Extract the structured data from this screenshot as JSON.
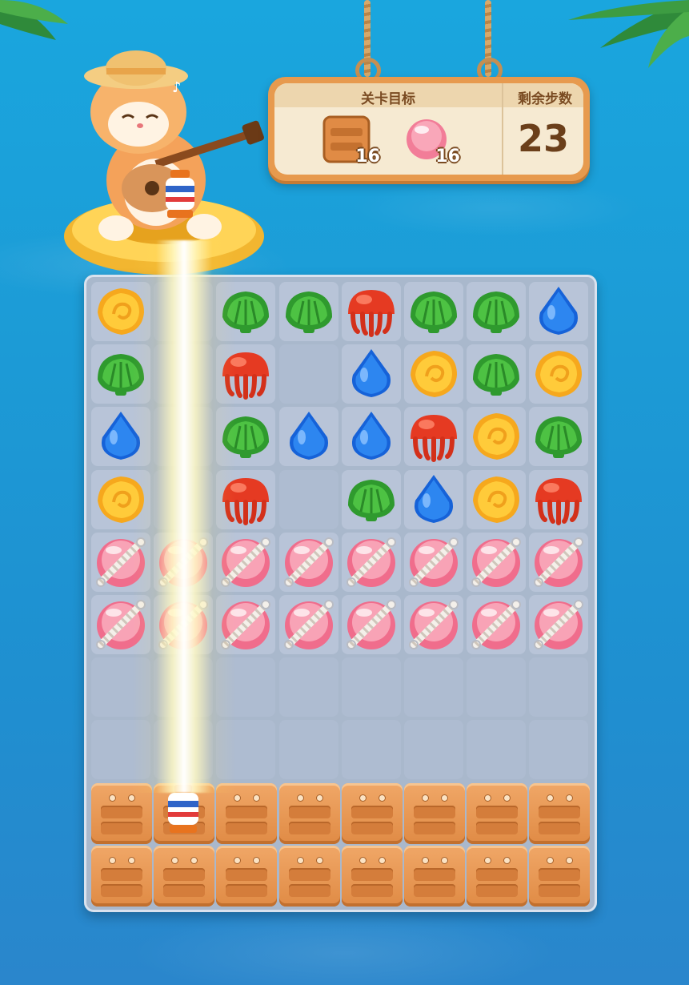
{
  "goal_panel": {
    "title": "关卡目标",
    "steps_title": "剩余步数",
    "steps_remaining": "23",
    "goals": [
      {
        "icon": "crate-icon",
        "count": "16"
      },
      {
        "icon": "pink-shell-icon",
        "count": "16"
      }
    ]
  },
  "colors": {
    "water": "#1c9bd6",
    "board": "#a9b8cc",
    "cell": "#b8c4d8",
    "crate": "#e08b45",
    "panel_frame": "#e79a4e"
  },
  "board": {
    "columns": 8,
    "rows": 10,
    "cells": [
      [
        "yellow-shell",
        "beam",
        "green-clam",
        "green-clam",
        "red-jelly",
        "green-clam",
        "green-clam",
        "blue-drop"
      ],
      [
        "green-clam",
        "beam",
        "red-jelly",
        "empty",
        "blue-drop",
        "yellow-shell",
        "green-clam",
        "yellow-shell"
      ],
      [
        "blue-drop",
        "beam",
        "green-clam",
        "blue-drop",
        "blue-drop",
        "red-jelly",
        "yellow-shell",
        "green-clam"
      ],
      [
        "yellow-shell",
        "beam",
        "red-jelly",
        "empty",
        "green-clam",
        "blue-drop",
        "yellow-shell",
        "red-jelly"
      ],
      [
        "roped-pink",
        "roped-pink",
        "roped-pink",
        "roped-pink",
        "roped-pink",
        "roped-pink",
        "roped-pink",
        "roped-pink"
      ],
      [
        "roped-pink",
        "roped-pink",
        "roped-pink",
        "roped-pink",
        "roped-pink",
        "roped-pink",
        "roped-pink",
        "roped-pink"
      ],
      [
        "empty",
        "empty",
        "empty",
        "empty",
        "empty",
        "empty",
        "empty",
        "empty"
      ],
      [
        "empty",
        "empty",
        "empty",
        "empty",
        "empty",
        "empty",
        "empty",
        "empty"
      ],
      [
        "crate",
        "lantern",
        "crate",
        "crate",
        "crate",
        "crate",
        "crate",
        "crate"
      ],
      [
        "crate",
        "crate",
        "crate",
        "crate",
        "crate",
        "crate",
        "crate",
        "crate"
      ]
    ]
  }
}
